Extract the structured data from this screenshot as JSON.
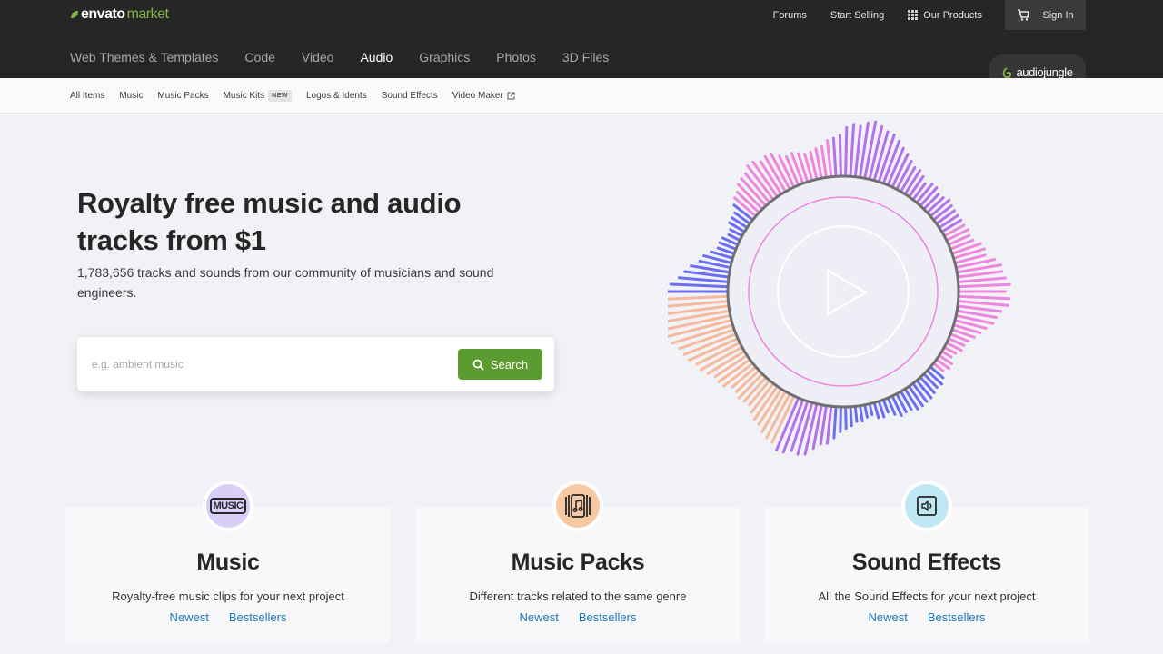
{
  "header": {
    "logo_part1": "envato",
    "logo_part2": "market",
    "top_links": [
      "Forums",
      "Start Selling",
      "Our Products"
    ],
    "sign_in": "Sign In",
    "categories": [
      "Web Themes & Templates",
      "Code",
      "Video",
      "Audio",
      "Graphics",
      "Photos",
      "3D Files"
    ],
    "active_category": "Audio",
    "site_badge": "audiojungle"
  },
  "subnav": {
    "items": [
      "All Items",
      "Music",
      "Music Packs",
      "Music Kits",
      "Logos & Idents",
      "Sound Effects",
      "Video Maker"
    ],
    "new_badge": "NEW"
  },
  "hero": {
    "title": "Royalty free music and audio tracks from $1",
    "subtitle": "1,783,656 tracks and sounds from our community of musicians and sound engineers.",
    "search_placeholder": "e.g. ambient music",
    "search_button": "Search"
  },
  "cards": [
    {
      "title": "Music",
      "desc": "Royalty-free music clips for your next project",
      "link1": "Newest",
      "link2": "Bestsellers",
      "icon_text": "MUSIC",
      "icon_bg": "#d9cef8"
    },
    {
      "title": "Music Packs",
      "desc": "Different tracks related to the same genre",
      "link1": "Newest",
      "link2": "Bestsellers",
      "icon_bg": "#f7c9a3"
    },
    {
      "title": "Sound Effects",
      "desc": "All the Sound Effects for your next project",
      "link1": "Newest",
      "link2": "Bestsellers",
      "icon_bg": "#bfe8f5"
    }
  ],
  "colors": {
    "header_bg": "#262626",
    "brand_green": "#82b541",
    "search_button": "#5c9b2f",
    "link_blue": "#1a7ab8",
    "wave_blue": "#6b6ef0",
    "wave_pink": "#ee86de",
    "wave_purple": "#b472ea",
    "wave_peach": "#f6b99c"
  }
}
